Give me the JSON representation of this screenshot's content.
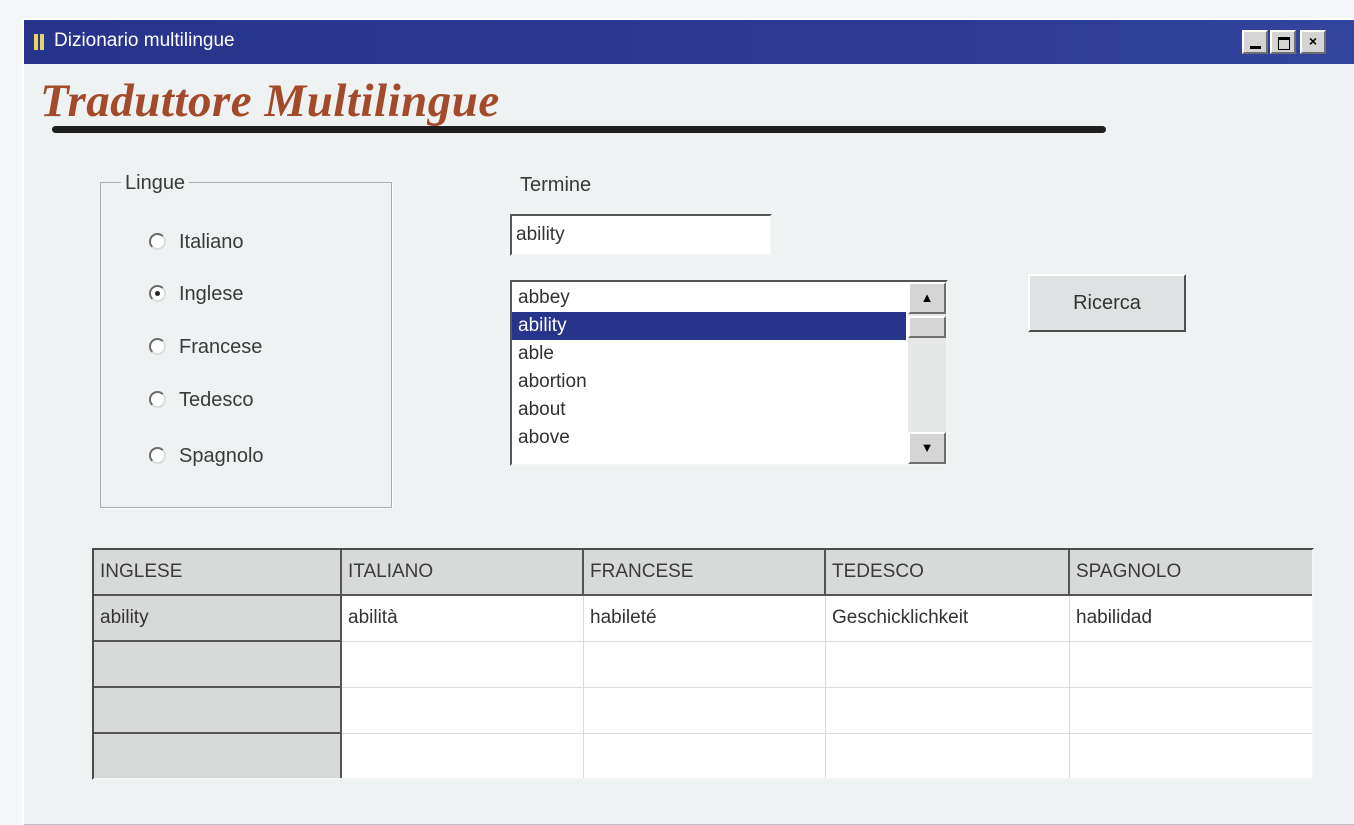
{
  "window": {
    "title": "Dizionario multilingue",
    "controls": {
      "minimize": "minimize",
      "maximize": "maximize",
      "close": "×"
    }
  },
  "heading": "Traduttore Multilingue",
  "lingue": {
    "label": "Lingue",
    "options": [
      {
        "label": "Italiano",
        "checked": false
      },
      {
        "label": "Inglese",
        "checked": true
      },
      {
        "label": "Francese",
        "checked": false
      },
      {
        "label": "Tedesco",
        "checked": false
      },
      {
        "label": "Spagnolo",
        "checked": false
      }
    ]
  },
  "termine": {
    "label": "Termine",
    "value": "ability"
  },
  "term_list": {
    "items": [
      "abbey",
      "ability",
      "able",
      "abortion",
      "about",
      "above"
    ],
    "selected": "ability",
    "scroll_up": "▲",
    "scroll_down": "▼"
  },
  "search_button": "Ricerca",
  "results_grid": {
    "columns": [
      "INGLESE",
      "ITALIANO",
      "FRANCESE",
      "TEDESCO",
      "SPAGNOLO"
    ],
    "rows": [
      [
        "ability",
        "abilità",
        "habileté",
        "Geschicklichkeit",
        "habilidad"
      ],
      [
        "",
        "",
        "",
        "",
        ""
      ],
      [
        "",
        "",
        "",
        "",
        ""
      ],
      [
        "",
        "",
        "",
        "",
        ""
      ]
    ]
  }
}
